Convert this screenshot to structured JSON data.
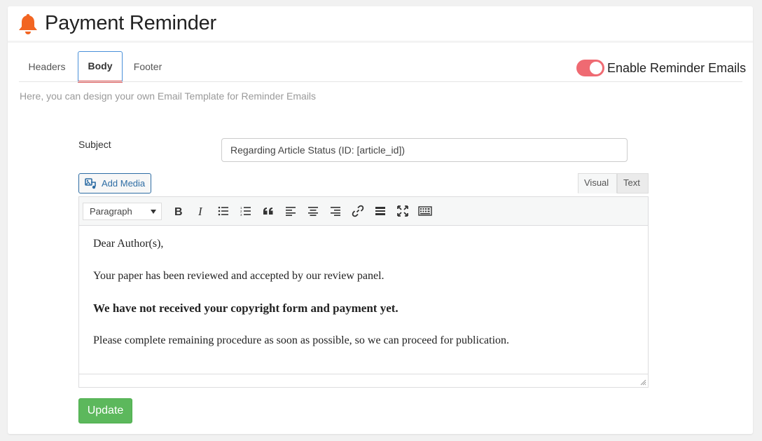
{
  "header": {
    "title": "Payment Reminder",
    "icon": "bell-icon",
    "icon_color": "#f26522"
  },
  "tabs": [
    {
      "label": "Headers",
      "active": false
    },
    {
      "label": "Body",
      "active": true
    },
    {
      "label": "Footer",
      "active": false
    }
  ],
  "toggle": {
    "label": "Enable Reminder Emails",
    "enabled": true,
    "color": "#ef6a72"
  },
  "help_text": "Here, you can design your own Email Template for Reminder Emails",
  "subject": {
    "label": "Subject",
    "value": "Regarding Article Status (ID: [article_id])"
  },
  "editor": {
    "add_media_label": "Add Media",
    "modes": {
      "visual": "Visual",
      "text": "Text"
    },
    "format_select": "Paragraph",
    "toolbar_icons": [
      "bold-icon",
      "italic-icon",
      "bullet-list-icon",
      "numbered-list-icon",
      "blockquote-icon",
      "align-left-icon",
      "align-center-icon",
      "align-right-icon",
      "link-icon",
      "read-more-icon",
      "fullscreen-icon",
      "toolbar-toggle-icon"
    ],
    "paragraphs": [
      "Dear Author(s),",
      "Your paper has been reviewed and accepted by our review panel.",
      "We have not received your copyright form and payment yet.",
      "Please complete remaining procedure as soon as possible, so we can proceed for publication."
    ]
  },
  "update_label": "Update",
  "update_color": "#5cb85c"
}
